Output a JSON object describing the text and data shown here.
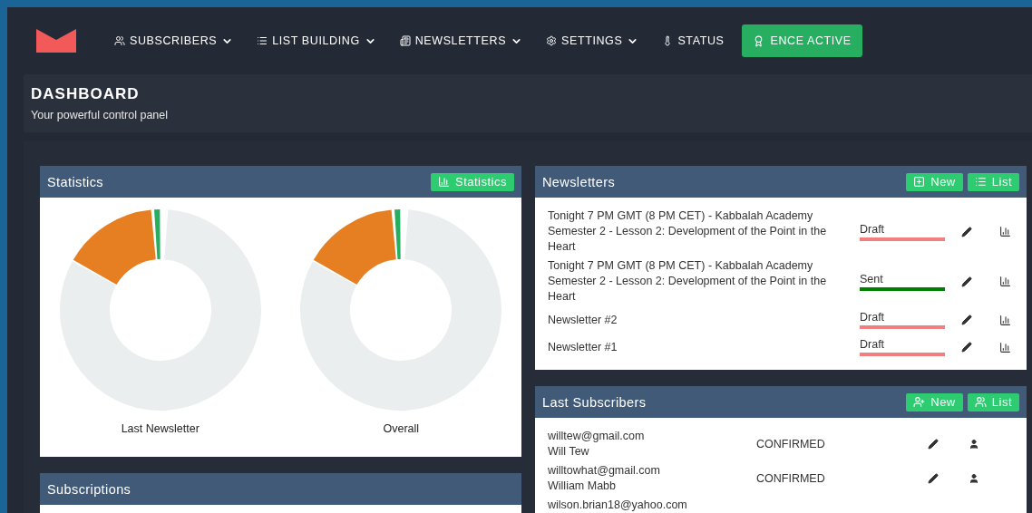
{
  "nav": {
    "items": [
      {
        "label": "SUBSCRIBERS",
        "kind": "users",
        "dropdown": true
      },
      {
        "label": "LIST BUILDING",
        "kind": "list",
        "dropdown": true
      },
      {
        "label": "NEWSLETTERS",
        "kind": "newspaper",
        "dropdown": true
      },
      {
        "label": "SETTINGS",
        "kind": "gear",
        "dropdown": true
      },
      {
        "label": "STATUS",
        "kind": "thermometer",
        "dropdown": false
      }
    ],
    "license_button": "ENCE ACTIVE"
  },
  "header": {
    "title": "DASHBOARD",
    "subtitle": "Your powerful control panel"
  },
  "statistics": {
    "title": "Statistics",
    "button": "Statistics",
    "charts": [
      {
        "label": "Last Newsletter"
      },
      {
        "label": "Overall"
      }
    ]
  },
  "subscriptions": {
    "title": "Subscriptions"
  },
  "newsletters": {
    "title": "Newsletters",
    "buttons": [
      {
        "label": "New",
        "kind": "plus"
      },
      {
        "label": "List",
        "kind": "list"
      }
    ],
    "rows": [
      {
        "title": "Tonight 7 PM GMT (8 PM CET) - Kabbalah Academy Semester 2 - Lesson 2: Development of the Point in the Heart",
        "status": "Draft",
        "color": "#f08080"
      },
      {
        "title": "Tonight 7 PM GMT (8 PM CET) - Kabbalah Academy Semester 2 - Lesson 2: Development of the Point in the Heart",
        "status": "Sent",
        "color": "#008000"
      },
      {
        "title": "Newsletter #2",
        "status": "Draft",
        "color": "#f08080"
      },
      {
        "title": "Newsletter #1",
        "status": "Draft",
        "color": "#f08080"
      }
    ]
  },
  "last_subscribers": {
    "title": "Last Subscribers",
    "buttons": [
      {
        "label": "New",
        "kind": "user-plus"
      },
      {
        "label": "List",
        "kind": "users"
      }
    ],
    "rows": [
      {
        "email": "willtew@gmail.com",
        "name": "Will Tew",
        "status": "CONFIRMED"
      },
      {
        "email": "willtowhat@gmail.com",
        "name": "William Mabb",
        "status": "CONFIRMED"
      },
      {
        "email": "wilson.brian18@yahoo.com"
      }
    ]
  }
}
